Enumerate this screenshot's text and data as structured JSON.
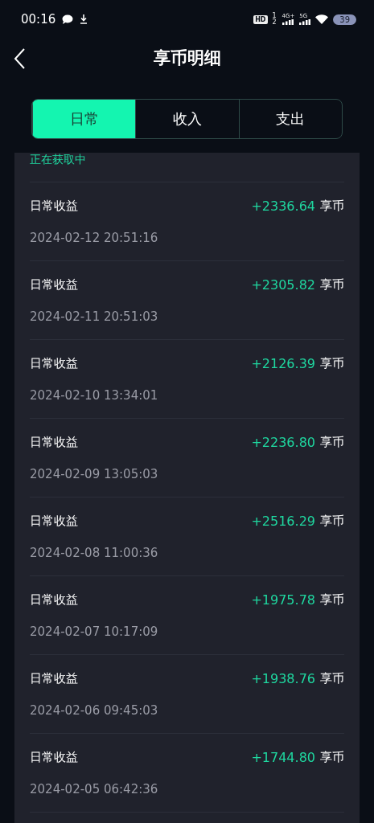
{
  "status_bar": {
    "time": "00:16",
    "hd": "HD",
    "hd_sub": "1 2",
    "networks": [
      "4G+",
      "5G"
    ],
    "battery": "39"
  },
  "header": {
    "title": "享币明细"
  },
  "tabs": [
    {
      "label": "日常",
      "selected": true
    },
    {
      "label": "收入",
      "selected": false
    },
    {
      "label": "支出",
      "selected": false
    }
  ],
  "loading_text": "正在获取中",
  "records": [
    {
      "title": "日常收益",
      "amount": "+2336.64",
      "unit": "享币",
      "time": "2024-02-12 20:51:16"
    },
    {
      "title": "日常收益",
      "amount": "+2305.82",
      "unit": "享币",
      "time": "2024-02-11 20:51:03"
    },
    {
      "title": "日常收益",
      "amount": "+2126.39",
      "unit": "享币",
      "time": "2024-02-10 13:34:01"
    },
    {
      "title": "日常收益",
      "amount": "+2236.80",
      "unit": "享币",
      "time": "2024-02-09 13:05:03"
    },
    {
      "title": "日常收益",
      "amount": "+2516.29",
      "unit": "享币",
      "time": "2024-02-08 11:00:36"
    },
    {
      "title": "日常收益",
      "amount": "+1975.78",
      "unit": "享币",
      "time": "2024-02-07 10:17:09"
    },
    {
      "title": "日常收益",
      "amount": "+1938.76",
      "unit": "享币",
      "time": "2024-02-06 09:45:03"
    },
    {
      "title": "日常收益",
      "amount": "+1744.80",
      "unit": "享币",
      "time": "2024-02-05 06:42:36"
    }
  ]
}
